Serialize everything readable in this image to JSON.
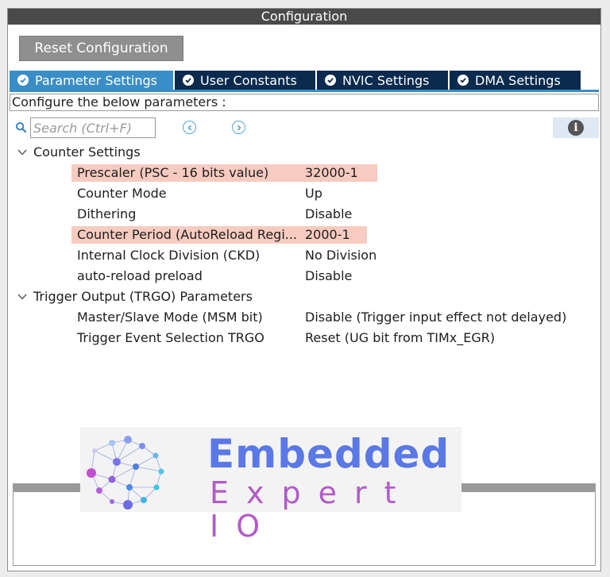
{
  "window": {
    "title": "Configuration"
  },
  "toolbar": {
    "reset_label": "Reset Configuration"
  },
  "tabs": [
    {
      "label": "Parameter Settings",
      "active": true
    },
    {
      "label": "User Constants",
      "active": false
    },
    {
      "label": "NVIC Settings",
      "active": false
    },
    {
      "label": "DMA Settings",
      "active": false
    }
  ],
  "description": "Configure the below parameters :",
  "search": {
    "placeholder": "Search (Ctrl+F)"
  },
  "groups": [
    {
      "label": "Counter Settings",
      "params": [
        {
          "name": "Prescaler (PSC - 16 bits value)",
          "value": "32000-1",
          "highlight": true
        },
        {
          "name": "Counter Mode",
          "value": "Up",
          "highlight": false
        },
        {
          "name": "Dithering",
          "value": "Disable",
          "highlight": false
        },
        {
          "name": "Counter Period (AutoReload Regi...",
          "value": "2000-1",
          "highlight": true
        },
        {
          "name": "Internal Clock Division (CKD)",
          "value": "No Division",
          "highlight": false
        },
        {
          "name": "auto-reload preload",
          "value": "Disable",
          "highlight": false
        }
      ]
    },
    {
      "label": "Trigger Output (TRGO) Parameters",
      "params": [
        {
          "name": "Master/Slave Mode (MSM bit)",
          "value": "Disable (Trigger input effect not delayed)",
          "highlight": false
        },
        {
          "name": "Trigger Event Selection TRGO",
          "value": "Reset (UG bit from TIMx_EGR)",
          "highlight": false
        }
      ]
    }
  ],
  "watermark": {
    "line1": "Embedded",
    "line2": "Expert IO"
  },
  "icons": {
    "search": "search-icon",
    "prev": "arrow-left-circle-icon",
    "next": "arrow-right-circle-icon",
    "info": "info-icon",
    "tab_check": "check-circle-icon",
    "expand": "chevron-down-icon"
  },
  "colors": {
    "tab_active": "#3a8ec8",
    "tab_inactive": "#0a2a4e",
    "highlight": "#f7cbc0",
    "brand_blue": "#5a78e6",
    "brand_purple": "#b15cc7"
  }
}
